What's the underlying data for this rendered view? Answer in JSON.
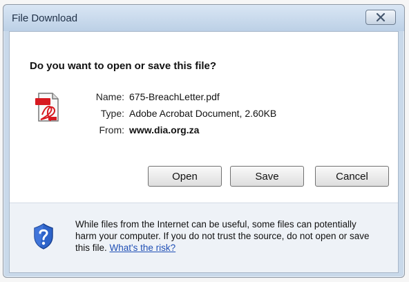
{
  "window": {
    "title": "File Download"
  },
  "dialog": {
    "question": "Do you want to open or save this file?",
    "file": {
      "name_label": "Name:",
      "name_value": "675-BreachLetter.pdf",
      "type_label": "Type:",
      "type_value": "Adobe Acrobat Document, 2.60KB",
      "from_label": "From:",
      "from_value": "www.dia.org.za",
      "icon": "pdf-file-icon"
    },
    "buttons": {
      "open": "Open",
      "save": "Save",
      "cancel": "Cancel"
    },
    "warning": {
      "text": "While files from the Internet can be useful, some files can potentially harm your computer. If you do not trust the source, do not open or save this file.",
      "link": "What's the risk?",
      "icon": "shield-question-icon"
    }
  }
}
